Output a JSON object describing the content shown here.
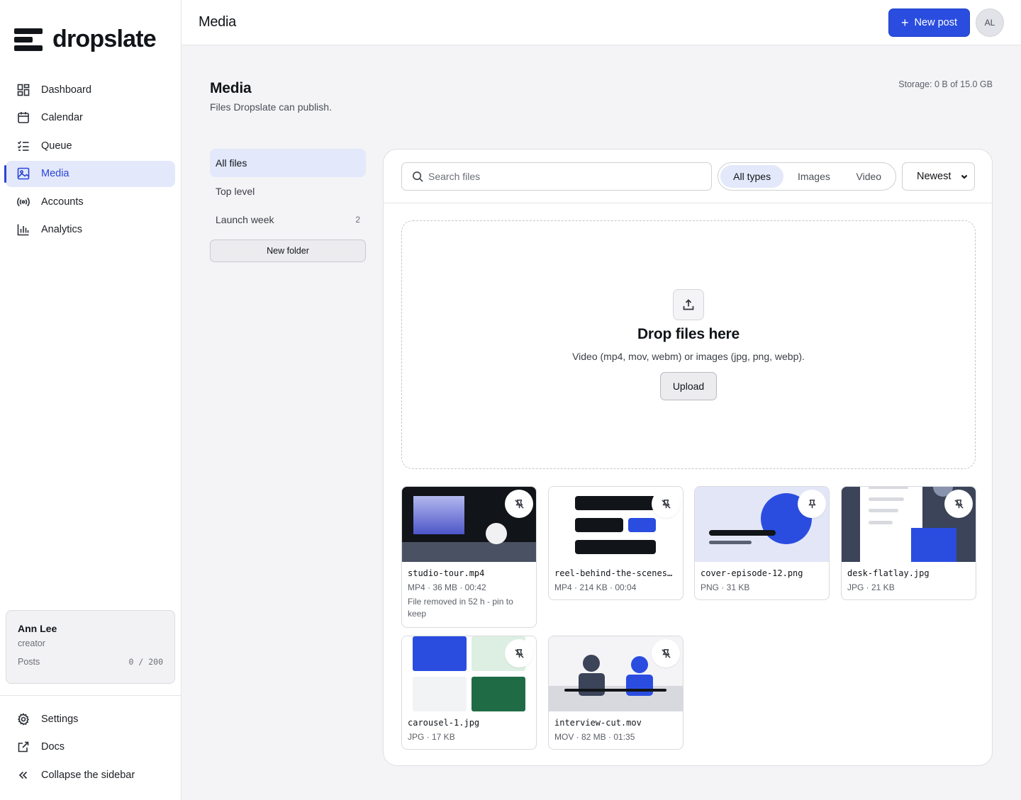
{
  "app": {
    "logo_text": "dropslate"
  },
  "sidebar": {
    "items": [
      {
        "label": "Dashboard",
        "icon": "grid-icon"
      },
      {
        "label": "Calendar",
        "icon": "calendar-icon"
      },
      {
        "label": "Queue",
        "icon": "queue-icon"
      },
      {
        "label": "Media",
        "icon": "image-icon",
        "active": true
      },
      {
        "label": "Accounts",
        "icon": "broadcast-icon"
      },
      {
        "label": "Analytics",
        "icon": "bar-chart-icon"
      }
    ],
    "user": {
      "name": "Ann Lee",
      "role": "creator",
      "posts_label": "Posts",
      "posts_value": "0 / 200"
    },
    "bottom": [
      {
        "label": "Settings",
        "icon": "gear-icon"
      },
      {
        "label": "Docs",
        "icon": "external-link-icon"
      },
      {
        "label": "Collapse the sidebar",
        "icon": "chevrons-left-icon"
      }
    ]
  },
  "topbar": {
    "title": "Media",
    "new_post": "New post",
    "avatar": "AL"
  },
  "header": {
    "title": "Media",
    "subtitle": "Files Dropslate can publish.",
    "storage": "Storage: 0 B of 15.0 GB"
  },
  "folders": {
    "items": [
      {
        "label": "All files",
        "count": "",
        "active": true
      },
      {
        "label": "Top level",
        "count": ""
      },
      {
        "label": "Launch week",
        "count": "2"
      }
    ],
    "new_folder": "New folder"
  },
  "toolbar": {
    "search_placeholder": "Search files",
    "types": [
      "All types",
      "Images",
      "Video"
    ],
    "active_type": "All types",
    "sort": "Newest"
  },
  "dropzone": {
    "title": "Drop files here",
    "subtitle": "Video (mp4, mov, webm) or images (jpg, png, webp).",
    "button": "Upload"
  },
  "files": [
    {
      "name": "studio-tour.mp4",
      "meta": "MP4 · 36 MB · 00:42",
      "warning": "File removed in 52 h - pin to keep",
      "pinned": false
    },
    {
      "name": "reel-behind-the-scenes…",
      "meta": "MP4 · 214 KB · 00:04",
      "pinned": false
    },
    {
      "name": "cover-episode-12.png",
      "meta": "PNG · 31 KB",
      "pinned": true
    },
    {
      "name": "desk-flatlay.jpg",
      "meta": "JPG · 21 KB",
      "pinned": false
    },
    {
      "name": "carousel-1.jpg",
      "meta": "JPG · 17 KB",
      "pinned": false
    },
    {
      "name": "interview-cut.mov",
      "meta": "MOV · 82 MB · 01:35",
      "pinned": false
    }
  ],
  "colors": {
    "accent": "#2a4de0",
    "active_bg": "#e3e8fb",
    "dark": "#111418"
  }
}
